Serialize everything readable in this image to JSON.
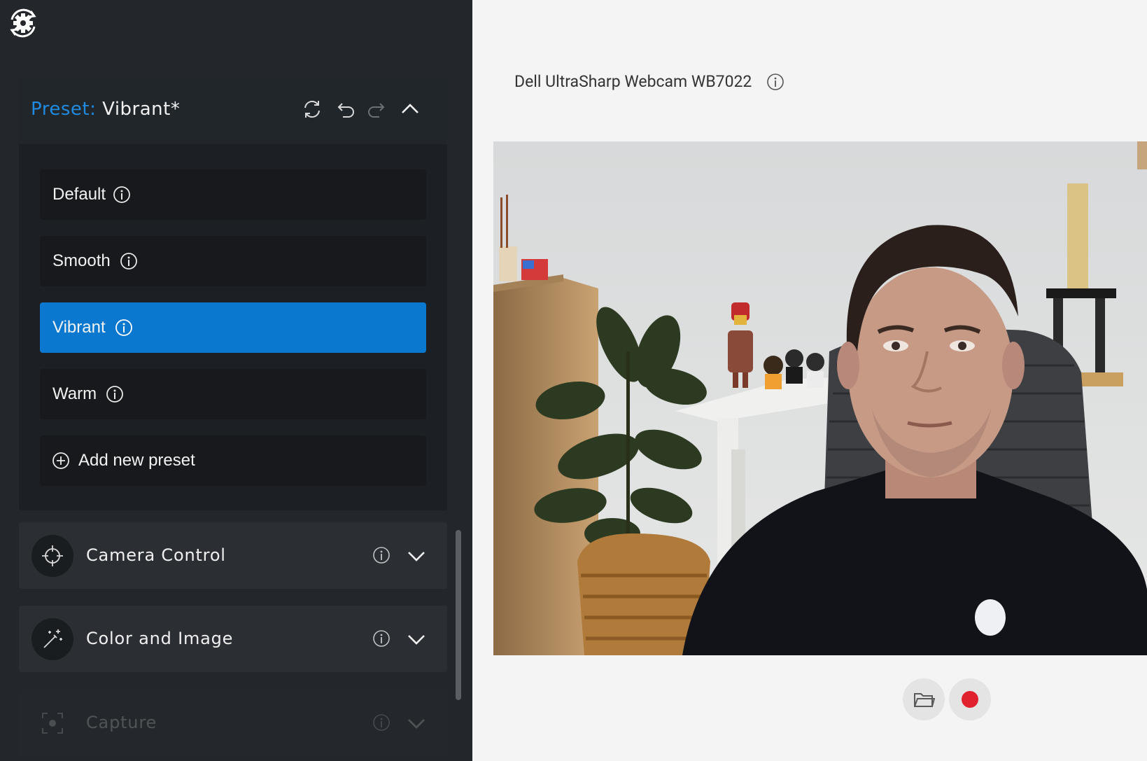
{
  "app": {
    "icon": "gear-refresh-icon"
  },
  "preset": {
    "label": "Preset:",
    "current": "Vibrant*",
    "actions": {
      "reset": "sync-icon",
      "undo": "undo-icon",
      "redo": "redo-icon",
      "collapse": "chevron-up-icon"
    },
    "items": [
      {
        "label": "Default",
        "active": false
      },
      {
        "label": "Smooth",
        "active": false
      },
      {
        "label": "Vibrant",
        "active": true
      },
      {
        "label": "Warm",
        "active": false
      }
    ],
    "add_label": "Add new preset"
  },
  "sections": [
    {
      "title": "Camera Control",
      "icon": "crosshair-icon"
    },
    {
      "title": "Color and Image",
      "icon": "magic-wand-icon"
    },
    {
      "title": "Capture",
      "icon": "capture-frame-icon"
    }
  ],
  "device": {
    "name": "Dell UltraSharp Webcam WB7022"
  },
  "controls": {
    "folder": "folder-icon",
    "record": "record-icon"
  },
  "colors": {
    "accent": "#0b78d0",
    "preset_label": "#1f8ae0",
    "record": "#e0212e",
    "sidebar_bg": "#23272b"
  }
}
